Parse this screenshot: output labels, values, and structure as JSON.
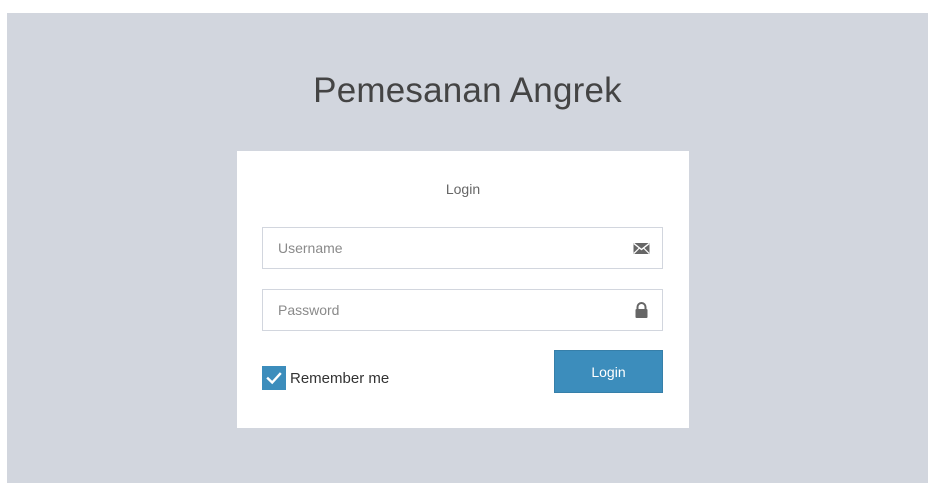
{
  "header": {
    "title": "Pemesanan Angrek"
  },
  "login_box": {
    "message": "Login",
    "username": {
      "placeholder": "Username",
      "value": "",
      "icon": "envelope-icon"
    },
    "password": {
      "placeholder": "Password",
      "value": "",
      "icon": "lock-icon"
    },
    "remember": {
      "label": "Remember me",
      "checked": true
    },
    "submit_label": "Login"
  },
  "colors": {
    "page_background": "#d2d6de",
    "box_background": "#ffffff",
    "accent": "#3c8dbc",
    "title_text": "#444444"
  }
}
